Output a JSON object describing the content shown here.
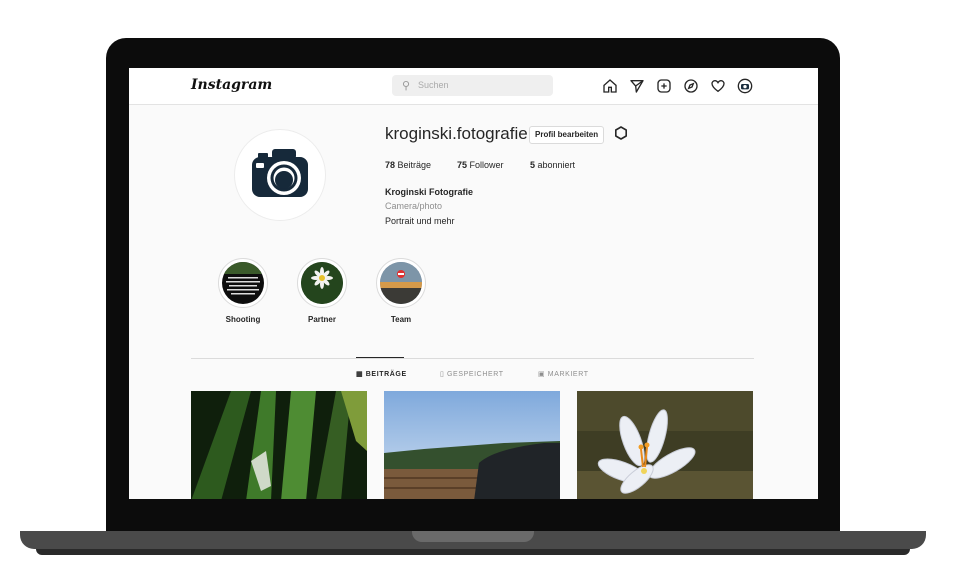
{
  "app": {
    "logo": "Instagram"
  },
  "search": {
    "placeholder": "Suchen"
  },
  "profile": {
    "username": "kroginski.fotografie",
    "edit_label": "Profil bearbeiten",
    "stats": [
      {
        "count": "78",
        "label": "Beiträge"
      },
      {
        "count": "75",
        "label": "Follower"
      },
      {
        "count": "5",
        "label": "abonniert"
      }
    ],
    "full_name": "Kroginski Fotografie",
    "category": "Camera/photo",
    "bio": "Portrait und mehr"
  },
  "highlights": [
    {
      "label": "Shooting"
    },
    {
      "label": "Partner"
    },
    {
      "label": "Team"
    }
  ],
  "tabs": [
    {
      "label": "BEITRÄGE",
      "icon": "grid-icon",
      "active": true
    },
    {
      "label": "GESPEICHERT",
      "icon": "bookmark-icon",
      "active": false
    },
    {
      "label": "MARKIERT",
      "icon": "tag-icon",
      "active": false
    }
  ],
  "icons": {
    "nav": [
      "home-icon",
      "direct-icon",
      "new-post-icon",
      "explore-icon",
      "activity-icon",
      "profile-avatar-icon"
    ],
    "settings": "gear-icon",
    "search": "search-icon"
  },
  "colors": {
    "text": "#262626",
    "muted": "#8e8e8e",
    "border": "#dbdbdb",
    "background": "#fafafa"
  }
}
